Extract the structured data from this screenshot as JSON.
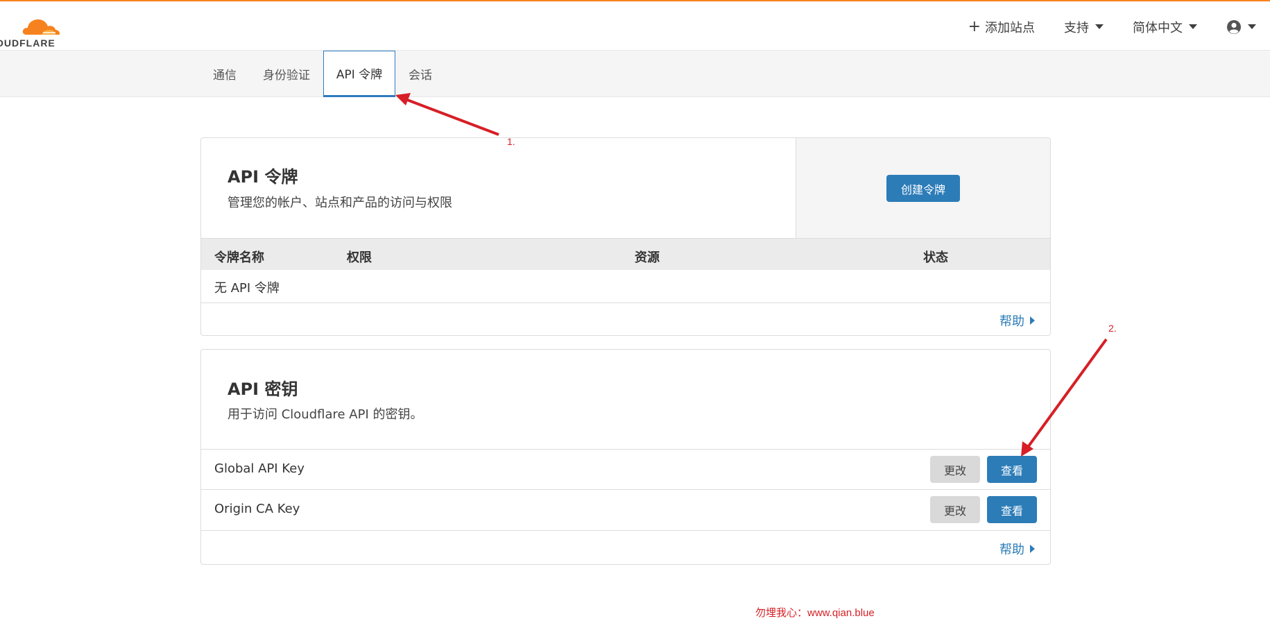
{
  "header": {
    "logo_text": "OUDFLARE",
    "add_site": "添加站点",
    "support": "支持",
    "language": "简体中文"
  },
  "tabs": [
    {
      "label": "通信"
    },
    {
      "label": "身份验证"
    },
    {
      "label": "API 令牌"
    },
    {
      "label": "会话"
    }
  ],
  "api_tokens": {
    "title": "API 令牌",
    "subtitle": "管理您的帐户、站点和产品的访问与权限",
    "create_button": "创建令牌",
    "columns": [
      "令牌名称",
      "权限",
      "资源",
      "状态"
    ],
    "empty_text": "无 API 令牌",
    "help": "帮助"
  },
  "api_keys": {
    "title": "API 密钥",
    "subtitle": "用于访问 Cloudflare API 的密钥。",
    "rows": [
      {
        "name": "Global API Key",
        "change": "更改",
        "view": "查看"
      },
      {
        "name": "Origin CA Key",
        "change": "更改",
        "view": "查看"
      }
    ],
    "help": "帮助"
  },
  "annotations": {
    "step1": "1.",
    "step2": "2.",
    "watermark": "勿埋我心：www.qian.blue"
  },
  "colors": {
    "brand_orange": "#f6821f",
    "primary_blue": "#2c7cb8",
    "annotation_red": "#d61f26"
  }
}
